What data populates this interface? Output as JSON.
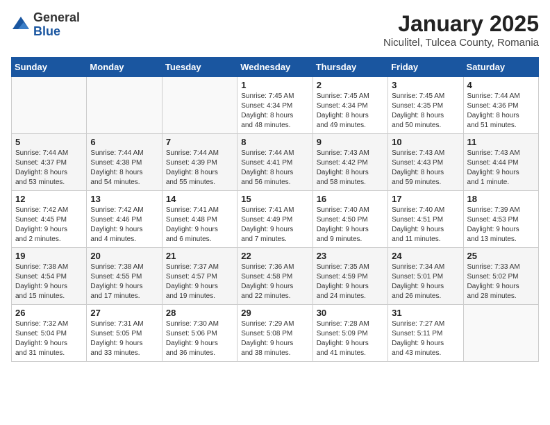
{
  "header": {
    "logo_general": "General",
    "logo_blue": "Blue",
    "title": "January 2025",
    "subtitle": "Niculitel, Tulcea County, Romania"
  },
  "days_of_week": [
    "Sunday",
    "Monday",
    "Tuesday",
    "Wednesday",
    "Thursday",
    "Friday",
    "Saturday"
  ],
  "weeks": [
    [
      {
        "day": "",
        "info": ""
      },
      {
        "day": "",
        "info": ""
      },
      {
        "day": "",
        "info": ""
      },
      {
        "day": "1",
        "info": "Sunrise: 7:45 AM\nSunset: 4:34 PM\nDaylight: 8 hours\nand 48 minutes."
      },
      {
        "day": "2",
        "info": "Sunrise: 7:45 AM\nSunset: 4:34 PM\nDaylight: 8 hours\nand 49 minutes."
      },
      {
        "day": "3",
        "info": "Sunrise: 7:45 AM\nSunset: 4:35 PM\nDaylight: 8 hours\nand 50 minutes."
      },
      {
        "day": "4",
        "info": "Sunrise: 7:44 AM\nSunset: 4:36 PM\nDaylight: 8 hours\nand 51 minutes."
      }
    ],
    [
      {
        "day": "5",
        "info": "Sunrise: 7:44 AM\nSunset: 4:37 PM\nDaylight: 8 hours\nand 53 minutes."
      },
      {
        "day": "6",
        "info": "Sunrise: 7:44 AM\nSunset: 4:38 PM\nDaylight: 8 hours\nand 54 minutes."
      },
      {
        "day": "7",
        "info": "Sunrise: 7:44 AM\nSunset: 4:39 PM\nDaylight: 8 hours\nand 55 minutes."
      },
      {
        "day": "8",
        "info": "Sunrise: 7:44 AM\nSunset: 4:41 PM\nDaylight: 8 hours\nand 56 minutes."
      },
      {
        "day": "9",
        "info": "Sunrise: 7:43 AM\nSunset: 4:42 PM\nDaylight: 8 hours\nand 58 minutes."
      },
      {
        "day": "10",
        "info": "Sunrise: 7:43 AM\nSunset: 4:43 PM\nDaylight: 8 hours\nand 59 minutes."
      },
      {
        "day": "11",
        "info": "Sunrise: 7:43 AM\nSunset: 4:44 PM\nDaylight: 9 hours\nand 1 minute."
      }
    ],
    [
      {
        "day": "12",
        "info": "Sunrise: 7:42 AM\nSunset: 4:45 PM\nDaylight: 9 hours\nand 2 minutes."
      },
      {
        "day": "13",
        "info": "Sunrise: 7:42 AM\nSunset: 4:46 PM\nDaylight: 9 hours\nand 4 minutes."
      },
      {
        "day": "14",
        "info": "Sunrise: 7:41 AM\nSunset: 4:48 PM\nDaylight: 9 hours\nand 6 minutes."
      },
      {
        "day": "15",
        "info": "Sunrise: 7:41 AM\nSunset: 4:49 PM\nDaylight: 9 hours\nand 7 minutes."
      },
      {
        "day": "16",
        "info": "Sunrise: 7:40 AM\nSunset: 4:50 PM\nDaylight: 9 hours\nand 9 minutes."
      },
      {
        "day": "17",
        "info": "Sunrise: 7:40 AM\nSunset: 4:51 PM\nDaylight: 9 hours\nand 11 minutes."
      },
      {
        "day": "18",
        "info": "Sunrise: 7:39 AM\nSunset: 4:53 PM\nDaylight: 9 hours\nand 13 minutes."
      }
    ],
    [
      {
        "day": "19",
        "info": "Sunrise: 7:38 AM\nSunset: 4:54 PM\nDaylight: 9 hours\nand 15 minutes."
      },
      {
        "day": "20",
        "info": "Sunrise: 7:38 AM\nSunset: 4:55 PM\nDaylight: 9 hours\nand 17 minutes."
      },
      {
        "day": "21",
        "info": "Sunrise: 7:37 AM\nSunset: 4:57 PM\nDaylight: 9 hours\nand 19 minutes."
      },
      {
        "day": "22",
        "info": "Sunrise: 7:36 AM\nSunset: 4:58 PM\nDaylight: 9 hours\nand 22 minutes."
      },
      {
        "day": "23",
        "info": "Sunrise: 7:35 AM\nSunset: 4:59 PM\nDaylight: 9 hours\nand 24 minutes."
      },
      {
        "day": "24",
        "info": "Sunrise: 7:34 AM\nSunset: 5:01 PM\nDaylight: 9 hours\nand 26 minutes."
      },
      {
        "day": "25",
        "info": "Sunrise: 7:33 AM\nSunset: 5:02 PM\nDaylight: 9 hours\nand 28 minutes."
      }
    ],
    [
      {
        "day": "26",
        "info": "Sunrise: 7:32 AM\nSunset: 5:04 PM\nDaylight: 9 hours\nand 31 minutes."
      },
      {
        "day": "27",
        "info": "Sunrise: 7:31 AM\nSunset: 5:05 PM\nDaylight: 9 hours\nand 33 minutes."
      },
      {
        "day": "28",
        "info": "Sunrise: 7:30 AM\nSunset: 5:06 PM\nDaylight: 9 hours\nand 36 minutes."
      },
      {
        "day": "29",
        "info": "Sunrise: 7:29 AM\nSunset: 5:08 PM\nDaylight: 9 hours\nand 38 minutes."
      },
      {
        "day": "30",
        "info": "Sunrise: 7:28 AM\nSunset: 5:09 PM\nDaylight: 9 hours\nand 41 minutes."
      },
      {
        "day": "31",
        "info": "Sunrise: 7:27 AM\nSunset: 5:11 PM\nDaylight: 9 hours\nand 43 minutes."
      },
      {
        "day": "",
        "info": ""
      }
    ]
  ]
}
